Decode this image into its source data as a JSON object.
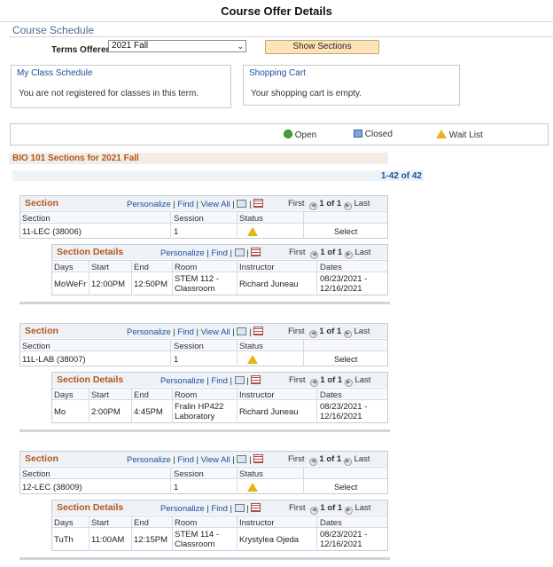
{
  "page": {
    "title": "Course Offer Details"
  },
  "schedule": {
    "heading": "Course Schedule",
    "terms_label": "Terms Offered",
    "terms_value": "2021 Fall",
    "show_button": "Show Sections"
  },
  "my_class_schedule": {
    "title": "My Class Schedule",
    "text": "You are not registered for classes in this term."
  },
  "shopping_cart": {
    "title": "Shopping Cart",
    "text": "Your shopping cart is empty."
  },
  "legend": {
    "open": "Open",
    "closed": "Closed",
    "wait_list": "Wait List"
  },
  "course": {
    "heading": "BIO 101 Sections for 2021 Fall",
    "count": "1-42 of 42"
  },
  "grid_nav": {
    "personalize": "Personalize",
    "find": "Find",
    "view_all": "View All",
    "first": "First",
    "last": "Last",
    "page": "1 of 1",
    "pipe": "|"
  },
  "section_labels": {
    "section_title": "Section",
    "details_title": "Section Details",
    "col_section": "Section",
    "col_session": "Session",
    "col_status": "Status",
    "col_days": "Days",
    "col_start": "Start",
    "col_end": "End",
    "col_room": "Room",
    "col_instructor": "Instructor",
    "col_dates": "Dates",
    "select": "Select"
  },
  "sections": [
    {
      "section": "11-LEC (38006)",
      "session": "1",
      "status": "wait-list",
      "days": "MoWeFr",
      "start": "12:00PM",
      "end": "12:50PM",
      "room_1": "STEM 112 -",
      "room_2": "Classroom",
      "instructor": "Richard Juneau",
      "dates_1": "08/23/2021 -",
      "dates_2": "12/16/2021"
    },
    {
      "section": "11L-LAB (38007)",
      "session": "1",
      "status": "wait-list",
      "days": "Mo",
      "start": "2:00PM",
      "end": "4:45PM",
      "room_1": "Fralin HP422",
      "room_2": "Laboratory",
      "instructor": "Richard Juneau",
      "dates_1": "08/23/2021 -",
      "dates_2": "12/16/2021"
    },
    {
      "section": "12-LEC (38009)",
      "session": "1",
      "status": "wait-list",
      "days": "TuTh",
      "start": "11:00AM",
      "end": "12:15PM",
      "room_1": "STEM 114 -",
      "room_2": "Classroom",
      "instructor": "Krystylea Ojeda",
      "dates_1": "08/23/2021 -",
      "dates_2": "12/16/2021"
    }
  ],
  "colors": {
    "accent_orange": "#b5551b",
    "link_blue": "#1f4fa0",
    "button_bg": "#fde3b8",
    "open_icon": "#3aa63a",
    "closed_icon": "#7fa7d9",
    "wait_icon": "#e6b515"
  }
}
